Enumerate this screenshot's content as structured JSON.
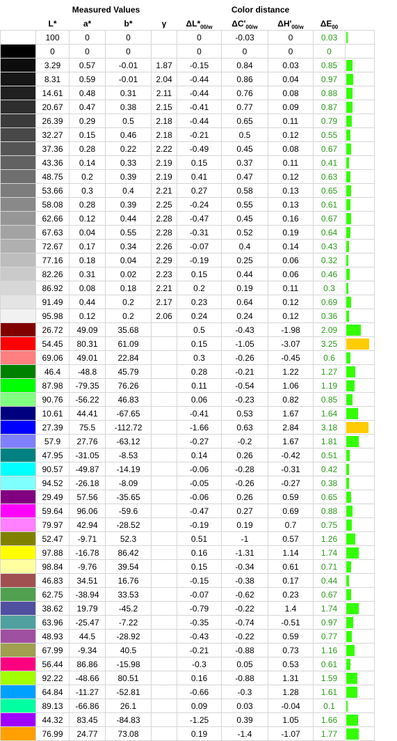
{
  "headings": {
    "measured": "Measured Values",
    "distance": "Color distance"
  },
  "columns": {
    "L": "L*",
    "a": "a*",
    "b": "b*",
    "gamma": "γ",
    "dL_main": "ΔL*",
    "dL_sub": "00/w",
    "dC_main": "ΔC'",
    "dC_sub": "00/w",
    "dH_main": "ΔH'",
    "dH_sub": "00/w",
    "dE_main": "ΔE",
    "dE_sub": "00"
  },
  "bar_colors": {
    "ok": "#33ff00",
    "warn": "#ffcc00"
  },
  "bar_scale_max": 3.25,
  "rows": [
    {
      "swatch": "#ffffff",
      "L": "100",
      "a": "0",
      "b": "0",
      "gamma": "",
      "dL": "0",
      "dC": "-0.03",
      "dH": "0",
      "dE": "0.03",
      "level": 0.03
    },
    {
      "swatch": "#000000",
      "L": "0",
      "a": "0",
      "b": "0",
      "gamma": "",
      "dL": "0",
      "dC": "0",
      "dH": "0",
      "dE": "0",
      "level": 0
    },
    {
      "swatch": "#0d0d0d",
      "L": "3.29",
      "a": "0.57",
      "b": "-0.01",
      "gamma": "1.87",
      "dL": "-0.15",
      "dC": "0.84",
      "dH": "0.03",
      "dE": "0.85",
      "level": 0.85
    },
    {
      "swatch": "#161616",
      "L": "8.31",
      "a": "0.59",
      "b": "-0.01",
      "gamma": "2.04",
      "dL": "-0.44",
      "dC": "0.86",
      "dH": "0.04",
      "dE": "0.97",
      "level": 0.97
    },
    {
      "swatch": "#202020",
      "L": "14.61",
      "a": "0.48",
      "b": "0.31",
      "gamma": "2.11",
      "dL": "-0.44",
      "dC": "0.76",
      "dH": "0.08",
      "dE": "0.88",
      "level": 0.88
    },
    {
      "swatch": "#2e2e2e",
      "L": "20.67",
      "a": "0.47",
      "b": "0.38",
      "gamma": "2.15",
      "dL": "-0.41",
      "dC": "0.77",
      "dH": "0.09",
      "dE": "0.87",
      "level": 0.87
    },
    {
      "swatch": "#3b3b3b",
      "L": "26.39",
      "a": "0.29",
      "b": "0.5",
      "gamma": "2.18",
      "dL": "-0.44",
      "dC": "0.65",
      "dH": "0.11",
      "dE": "0.79",
      "level": 0.79
    },
    {
      "swatch": "#484848",
      "L": "32.27",
      "a": "0.15",
      "b": "0.46",
      "gamma": "2.18",
      "dL": "-0.21",
      "dC": "0.5",
      "dH": "0.12",
      "dE": "0.55",
      "level": 0.55
    },
    {
      "swatch": "#555555",
      "L": "37.36",
      "a": "0.28",
      "b": "0.22",
      "gamma": "2.22",
      "dL": "-0.49",
      "dC": "0.45",
      "dH": "0.08",
      "dE": "0.67",
      "level": 0.67
    },
    {
      "swatch": "#626262",
      "L": "43.36",
      "a": "0.14",
      "b": "0.33",
      "gamma": "2.19",
      "dL": "0.15",
      "dC": "0.37",
      "dH": "0.11",
      "dE": "0.41",
      "level": 0.41
    },
    {
      "swatch": "#6f6f6f",
      "L": "48.75",
      "a": "0.2",
      "b": "0.39",
      "gamma": "2.19",
      "dL": "0.41",
      "dC": "0.47",
      "dH": "0.12",
      "dE": "0.63",
      "level": 0.63
    },
    {
      "swatch": "#7c7c7c",
      "L": "53.66",
      "a": "0.3",
      "b": "0.4",
      "gamma": "2.21",
      "dL": "0.27",
      "dC": "0.58",
      "dH": "0.13",
      "dE": "0.65",
      "level": 0.65
    },
    {
      "swatch": "#898989",
      "L": "58.08",
      "a": "0.28",
      "b": "0.39",
      "gamma": "2.25",
      "dL": "-0.24",
      "dC": "0.55",
      "dH": "0.13",
      "dE": "0.61",
      "level": 0.61
    },
    {
      "swatch": "#969696",
      "L": "62.66",
      "a": "0.12",
      "b": "0.44",
      "gamma": "2.28",
      "dL": "-0.47",
      "dC": "0.45",
      "dH": "0.16",
      "dE": "0.67",
      "level": 0.67
    },
    {
      "swatch": "#a3a3a3",
      "L": "67.63",
      "a": "0.04",
      "b": "0.55",
      "gamma": "2.28",
      "dL": "-0.31",
      "dC": "0.52",
      "dH": "0.19",
      "dE": "0.64",
      "level": 0.64
    },
    {
      "swatch": "#b0b0b0",
      "L": "72.67",
      "a": "0.17",
      "b": "0.34",
      "gamma": "2.26",
      "dL": "-0.07",
      "dC": "0.4",
      "dH": "0.14",
      "dE": "0.43",
      "level": 0.43
    },
    {
      "swatch": "#bdbdbd",
      "L": "77.16",
      "a": "0.18",
      "b": "0.04",
      "gamma": "2.29",
      "dL": "-0.19",
      "dC": "0.25",
      "dH": "0.06",
      "dE": "0.32",
      "level": 0.32
    },
    {
      "swatch": "#cacaca",
      "L": "82.26",
      "a": "0.31",
      "b": "0.02",
      "gamma": "2.23",
      "dL": "0.15",
      "dC": "0.44",
      "dH": "0.06",
      "dE": "0.46",
      "level": 0.46
    },
    {
      "swatch": "#d7d7d7",
      "L": "86.92",
      "a": "0.08",
      "b": "0.18",
      "gamma": "2.21",
      "dL": "0.2",
      "dC": "0.19",
      "dH": "0.11",
      "dE": "0.3",
      "level": 0.3
    },
    {
      "swatch": "#e4e4e4",
      "L": "91.49",
      "a": "0.44",
      "b": "0.2",
      "gamma": "2.17",
      "dL": "0.23",
      "dC": "0.64",
      "dH": "0.12",
      "dE": "0.69",
      "level": 0.69
    },
    {
      "swatch": "#f1f1f1",
      "L": "95.98",
      "a": "0.12",
      "b": "0.2",
      "gamma": "2.06",
      "dL": "0.24",
      "dC": "0.24",
      "dH": "0.12",
      "dE": "0.36",
      "level": 0.36
    },
    {
      "swatch": "#800000",
      "L": "26.72",
      "a": "49.09",
      "b": "35.68",
      "gamma": "",
      "dL": "0.5",
      "dC": "-0.43",
      "dH": "-1.98",
      "dE": "2.09",
      "level": 2.09
    },
    {
      "swatch": "#ff0000",
      "L": "54.45",
      "a": "80.31",
      "b": "61.09",
      "gamma": "",
      "dL": "0.15",
      "dC": "-1.05",
      "dH": "-3.07",
      "dE": "3.25",
      "level": 3.25
    },
    {
      "swatch": "#ff8080",
      "L": "69.06",
      "a": "49.01",
      "b": "22.84",
      "gamma": "",
      "dL": "0.3",
      "dC": "-0.26",
      "dH": "-0.45",
      "dE": "0.6",
      "level": 0.6
    },
    {
      "swatch": "#008000",
      "L": "46.4",
      "a": "-48.8",
      "b": "45.79",
      "gamma": "",
      "dL": "0.28",
      "dC": "-0.21",
      "dH": "1.22",
      "dE": "1.27",
      "level": 1.27
    },
    {
      "swatch": "#00ff00",
      "L": "87.98",
      "a": "-79.35",
      "b": "76.26",
      "gamma": "",
      "dL": "0.11",
      "dC": "-0.54",
      "dH": "1.06",
      "dE": "1.19",
      "level": 1.19
    },
    {
      "swatch": "#80ff80",
      "L": "90.76",
      "a": "-56.22",
      "b": "46.83",
      "gamma": "",
      "dL": "0.06",
      "dC": "-0.23",
      "dH": "0.82",
      "dE": "0.85",
      "level": 0.85
    },
    {
      "swatch": "#000080",
      "L": "10.61",
      "a": "44.41",
      "b": "-67.65",
      "gamma": "",
      "dL": "-0.41",
      "dC": "0.53",
      "dH": "1.67",
      "dE": "1.64",
      "level": 1.64
    },
    {
      "swatch": "#0000ff",
      "L": "27.39",
      "a": "75.5",
      "b": "-112.72",
      "gamma": "",
      "dL": "-1.66",
      "dC": "0.63",
      "dH": "2.84",
      "dE": "3.18",
      "level": 3.18
    },
    {
      "swatch": "#8080ff",
      "L": "57.9",
      "a": "27.76",
      "b": "-63.12",
      "gamma": "",
      "dL": "-0.27",
      "dC": "-0.2",
      "dH": "1.67",
      "dE": "1.81",
      "level": 1.81
    },
    {
      "swatch": "#008080",
      "L": "47.95",
      "a": "-31.05",
      "b": "-8.53",
      "gamma": "",
      "dL": "0.14",
      "dC": "0.26",
      "dH": "-0.42",
      "dE": "0.51",
      "level": 0.51
    },
    {
      "swatch": "#00ffff",
      "L": "90.57",
      "a": "-49.87",
      "b": "-14.19",
      "gamma": "",
      "dL": "-0.06",
      "dC": "-0.28",
      "dH": "-0.31",
      "dE": "0.42",
      "level": 0.42
    },
    {
      "swatch": "#80ffff",
      "L": "94.52",
      "a": "-26.18",
      "b": "-8.09",
      "gamma": "",
      "dL": "-0.05",
      "dC": "-0.26",
      "dH": "-0.27",
      "dE": "0.38",
      "level": 0.38
    },
    {
      "swatch": "#800080",
      "L": "29.49",
      "a": "57.56",
      "b": "-35.65",
      "gamma": "",
      "dL": "-0.06",
      "dC": "0.26",
      "dH": "0.59",
      "dE": "0.65",
      "level": 0.65
    },
    {
      "swatch": "#ff00ff",
      "L": "59.64",
      "a": "96.06",
      "b": "-59.6",
      "gamma": "",
      "dL": "-0.47",
      "dC": "0.27",
      "dH": "0.69",
      "dE": "0.88",
      "level": 0.88
    },
    {
      "swatch": "#ff80ff",
      "L": "79.97",
      "a": "42.94",
      "b": "-28.52",
      "gamma": "",
      "dL": "-0.19",
      "dC": "0.19",
      "dH": "0.7",
      "dE": "0.75",
      "level": 0.75
    },
    {
      "swatch": "#808000",
      "L": "52.47",
      "a": "-9.71",
      "b": "52.3",
      "gamma": "",
      "dL": "0.51",
      "dC": "-1",
      "dH": "0.57",
      "dE": "1.26",
      "level": 1.26
    },
    {
      "swatch": "#ffff00",
      "L": "97.88",
      "a": "-16.78",
      "b": "86.42",
      "gamma": "",
      "dL": "0.16",
      "dC": "-1.31",
      "dH": "1.14",
      "dE": "1.74",
      "level": 1.74
    },
    {
      "swatch": "#ffffa0",
      "L": "98.84",
      "a": "-9.76",
      "b": "39.54",
      "gamma": "",
      "dL": "0.15",
      "dC": "-0.34",
      "dH": "0.61",
      "dE": "0.71",
      "level": 0.71
    },
    {
      "swatch": "#a05050",
      "L": "46.83",
      "a": "34.51",
      "b": "16.76",
      "gamma": "",
      "dL": "-0.15",
      "dC": "-0.38",
      "dH": "0.17",
      "dE": "0.44",
      "level": 0.44
    },
    {
      "swatch": "#50a050",
      "L": "62.75",
      "a": "-38.94",
      "b": "33.53",
      "gamma": "",
      "dL": "-0.07",
      "dC": "-0.62",
      "dH": "0.23",
      "dE": "0.67",
      "level": 0.67
    },
    {
      "swatch": "#5050a0",
      "L": "38.62",
      "a": "19.79",
      "b": "-45.2",
      "gamma": "",
      "dL": "-0.79",
      "dC": "-0.22",
      "dH": "1.4",
      "dE": "1.74",
      "level": 1.74
    },
    {
      "swatch": "#50a0a0",
      "L": "63.96",
      "a": "-25.47",
      "b": "-7.22",
      "gamma": "",
      "dL": "-0.35",
      "dC": "-0.74",
      "dH": "-0.51",
      "dE": "0.97",
      "level": 0.97
    },
    {
      "swatch": "#a050a0",
      "L": "48.93",
      "a": "44.5",
      "b": "-28.92",
      "gamma": "",
      "dL": "-0.43",
      "dC": "-0.22",
      "dH": "0.59",
      "dE": "0.77",
      "level": 0.77
    },
    {
      "swatch": "#a0a050",
      "L": "67.99",
      "a": "-9.34",
      "b": "40.5",
      "gamma": "",
      "dL": "-0.21",
      "dC": "-0.88",
      "dH": "0.73",
      "dE": "1.16",
      "level": 1.16
    },
    {
      "swatch": "#ff0080",
      "L": "56.44",
      "a": "86.86",
      "b": "-15.98",
      "gamma": "",
      "dL": "-0.3",
      "dC": "0.05",
      "dH": "0.53",
      "dE": "0.61",
      "level": 0.61
    },
    {
      "swatch": "#a0ff00",
      "L": "92.22",
      "a": "-48.66",
      "b": "80.51",
      "gamma": "",
      "dL": "0.16",
      "dC": "-0.88",
      "dH": "1.31",
      "dE": "1.59",
      "level": 1.59
    },
    {
      "swatch": "#00a0ff",
      "L": "64.84",
      "a": "-11.27",
      "b": "-52.81",
      "gamma": "",
      "dL": "-0.66",
      "dC": "-0.3",
      "dH": "1.28",
      "dE": "1.61",
      "level": 1.61
    },
    {
      "swatch": "#00ffa0",
      "L": "89.13",
      "a": "-66.86",
      "b": "26.1",
      "gamma": "",
      "dL": "0.09",
      "dC": "0.03",
      "dH": "-0.04",
      "dE": "0.1",
      "level": 0.1
    },
    {
      "swatch": "#a000ff",
      "L": "44.32",
      "a": "83.45",
      "b": "-84.83",
      "gamma": "",
      "dL": "-1.25",
      "dC": "0.39",
      "dH": "1.05",
      "dE": "1.66",
      "level": 1.66
    },
    {
      "swatch": "#ffa000",
      "L": "76.99",
      "a": "24.77",
      "b": "73.08",
      "gamma": "",
      "dL": "0.19",
      "dC": "-1.4",
      "dH": "-1.07",
      "dE": "1.77",
      "level": 1.77
    }
  ]
}
